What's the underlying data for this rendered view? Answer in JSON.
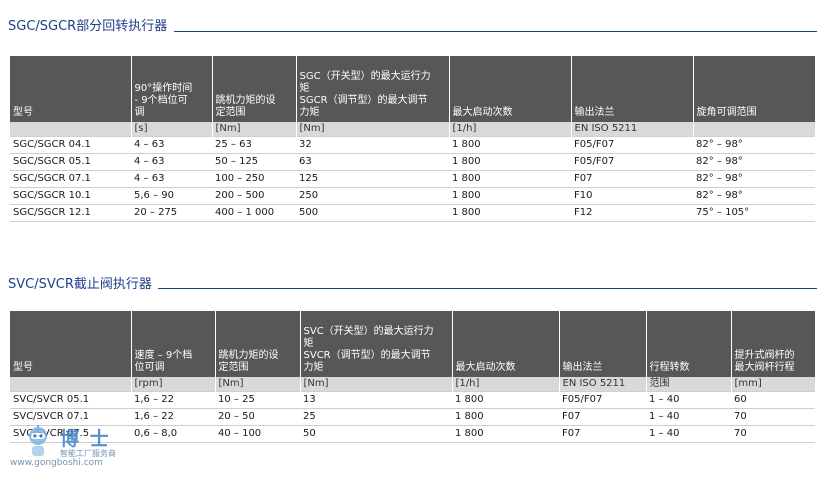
{
  "sgc": {
    "title": "SGC/SGCR部分回转执行器",
    "headers": [
      "型号",
      "90°操作时间\n- 9个档位可\n调",
      "跳机力矩的设\n定范围",
      "SGC（开关型）的最大运行力\n矩\nSGCR（调节型）的最大调节\n力矩",
      "最大启动次数",
      "输出法兰",
      "旋角可调范围"
    ],
    "units": [
      "",
      "[s]",
      "[Nm]",
      "[Nm]",
      "[1/h]",
      "EN  ISO  5211",
      ""
    ],
    "rows": [
      [
        "SGC/SGCR 04.1",
        "4 – 63",
        "25 – 63",
        "32",
        "1 800",
        "F05/F07",
        "82°  –  98°"
      ],
      [
        "SGC/SGCR 05.1",
        "4 – 63",
        "50 – 125",
        "63",
        "1 800",
        "F05/F07",
        "82°  –  98°"
      ],
      [
        "SGC/SGCR 07.1",
        "4 – 63",
        "100 – 250",
        "125",
        "1 800",
        "F07",
        "82°  –  98°"
      ],
      [
        "SGC/SGCR 10.1",
        "5,6 – 90",
        "200 – 500",
        "250",
        "1 800",
        "F10",
        "82°  –  98°"
      ],
      [
        "SGC/SGCR 12.1",
        "20 – 275",
        "400 – 1 000",
        "500",
        "1 800",
        "F12",
        "75°  –  105°"
      ]
    ]
  },
  "svc": {
    "title": "SVC/SVCR截止阀执行器",
    "headers": [
      "型号",
      "速度  –  9个档\n位可调",
      "跳机力矩的设\n定范围",
      "SVC（开关型）的最大运行力\n矩\nSVCR（调节型）的最大调节\n力矩",
      "最大启动次数",
      "输出法兰",
      "行程转数",
      "提升式阀杆的\n最大阀杆行程"
    ],
    "units": [
      "",
      "[rpm]",
      "[Nm]",
      "[Nm]",
      "[1/h]",
      "EN  ISO  5211",
      "范围",
      "[mm]"
    ],
    "rows": [
      [
        "SVC/SVCR 05.1",
        "1,6 – 22",
        "10 – 25",
        "13",
        "1 800",
        "F05/F07",
        "1 – 40",
        "60"
      ],
      [
        "SVC/SVCR 07.1",
        "1,6 – 22",
        "20 – 50",
        "25",
        "1 800",
        "F07",
        "1 – 40",
        "70"
      ],
      [
        "SVC/SVCR 07.5",
        "0,6 – 8,0",
        "40 – 100",
        "50",
        "1 800",
        "F07",
        "1 – 40",
        "70"
      ]
    ]
  },
  "watermark": {
    "brand": "博 士",
    "subtitle": "智能工厂服务商",
    "url": "www.gongboshi.com"
  }
}
